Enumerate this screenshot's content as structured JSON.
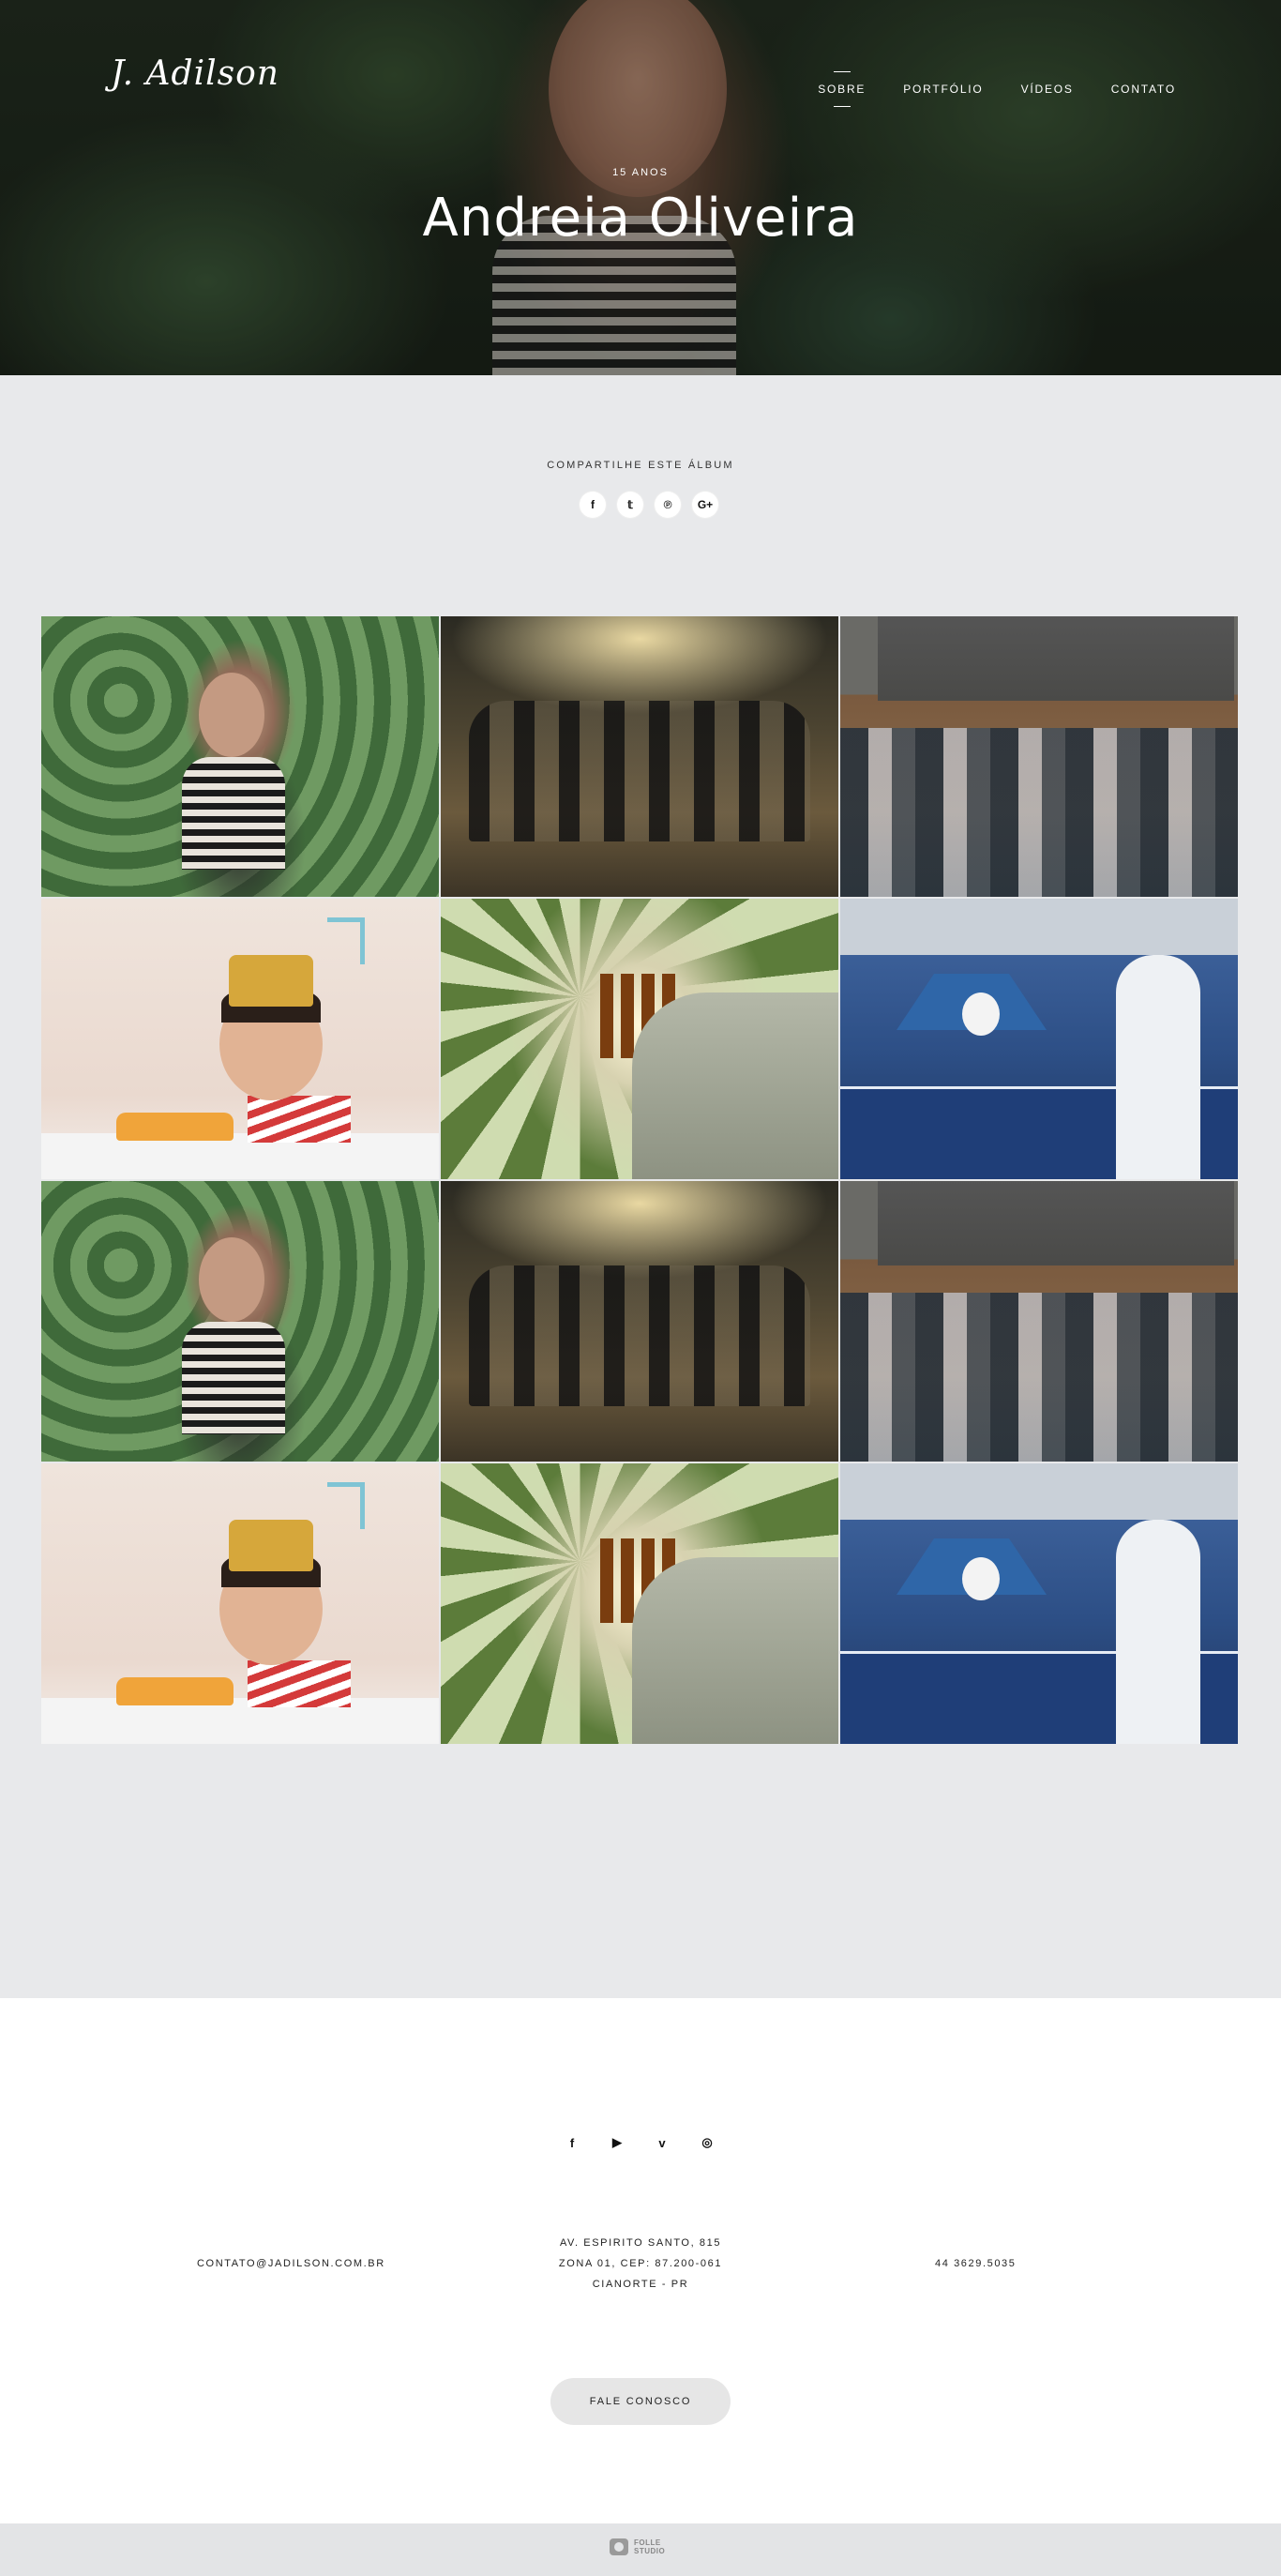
{
  "header": {
    "logo": "J. Adilson",
    "nav": [
      "SOBRE",
      "PORTFÓLIO",
      "VÍDEOS",
      "CONTATO"
    ],
    "active_nav": "SOBRE",
    "subtitle": "15 ANOS",
    "title": "Andreia Oliveira"
  },
  "share": {
    "label": "COMPARTILHE ESTE ÁLBUM",
    "icons": [
      {
        "name": "facebook-icon",
        "glyph": "f"
      },
      {
        "name": "twitter-icon",
        "glyph": "𝕥"
      },
      {
        "name": "pinterest-icon",
        "glyph": "℗"
      },
      {
        "name": "google-plus-icon",
        "glyph": "G+"
      }
    ]
  },
  "gallery": {
    "photos": [
      "plants",
      "tent-party",
      "church-wedding",
      "baby-cake",
      "palm-toast",
      "ping-pong-party",
      "plants",
      "tent-party",
      "church-wedding",
      "baby-cake",
      "palm-toast",
      "ping-pong-party"
    ]
  },
  "footer": {
    "social": [
      {
        "name": "facebook-icon",
        "glyph": "f"
      },
      {
        "name": "youtube-icon",
        "glyph": "▶"
      },
      {
        "name": "vimeo-icon",
        "glyph": "v"
      },
      {
        "name": "instagram-icon",
        "glyph": "◎"
      }
    ],
    "email": "CONTATO@JADILSON.COM.BR",
    "address_line1": "AV. ESPIRITO SANTO, 815",
    "address_line2": "ZONA 01, CEP: 87.200-061",
    "address_line3": "CIANORTE - PR",
    "phone": "44 3629.5035",
    "cta": "FALE CONOSCO"
  },
  "brand": {
    "line1": "FOLLE",
    "line2": "STUDIO"
  }
}
